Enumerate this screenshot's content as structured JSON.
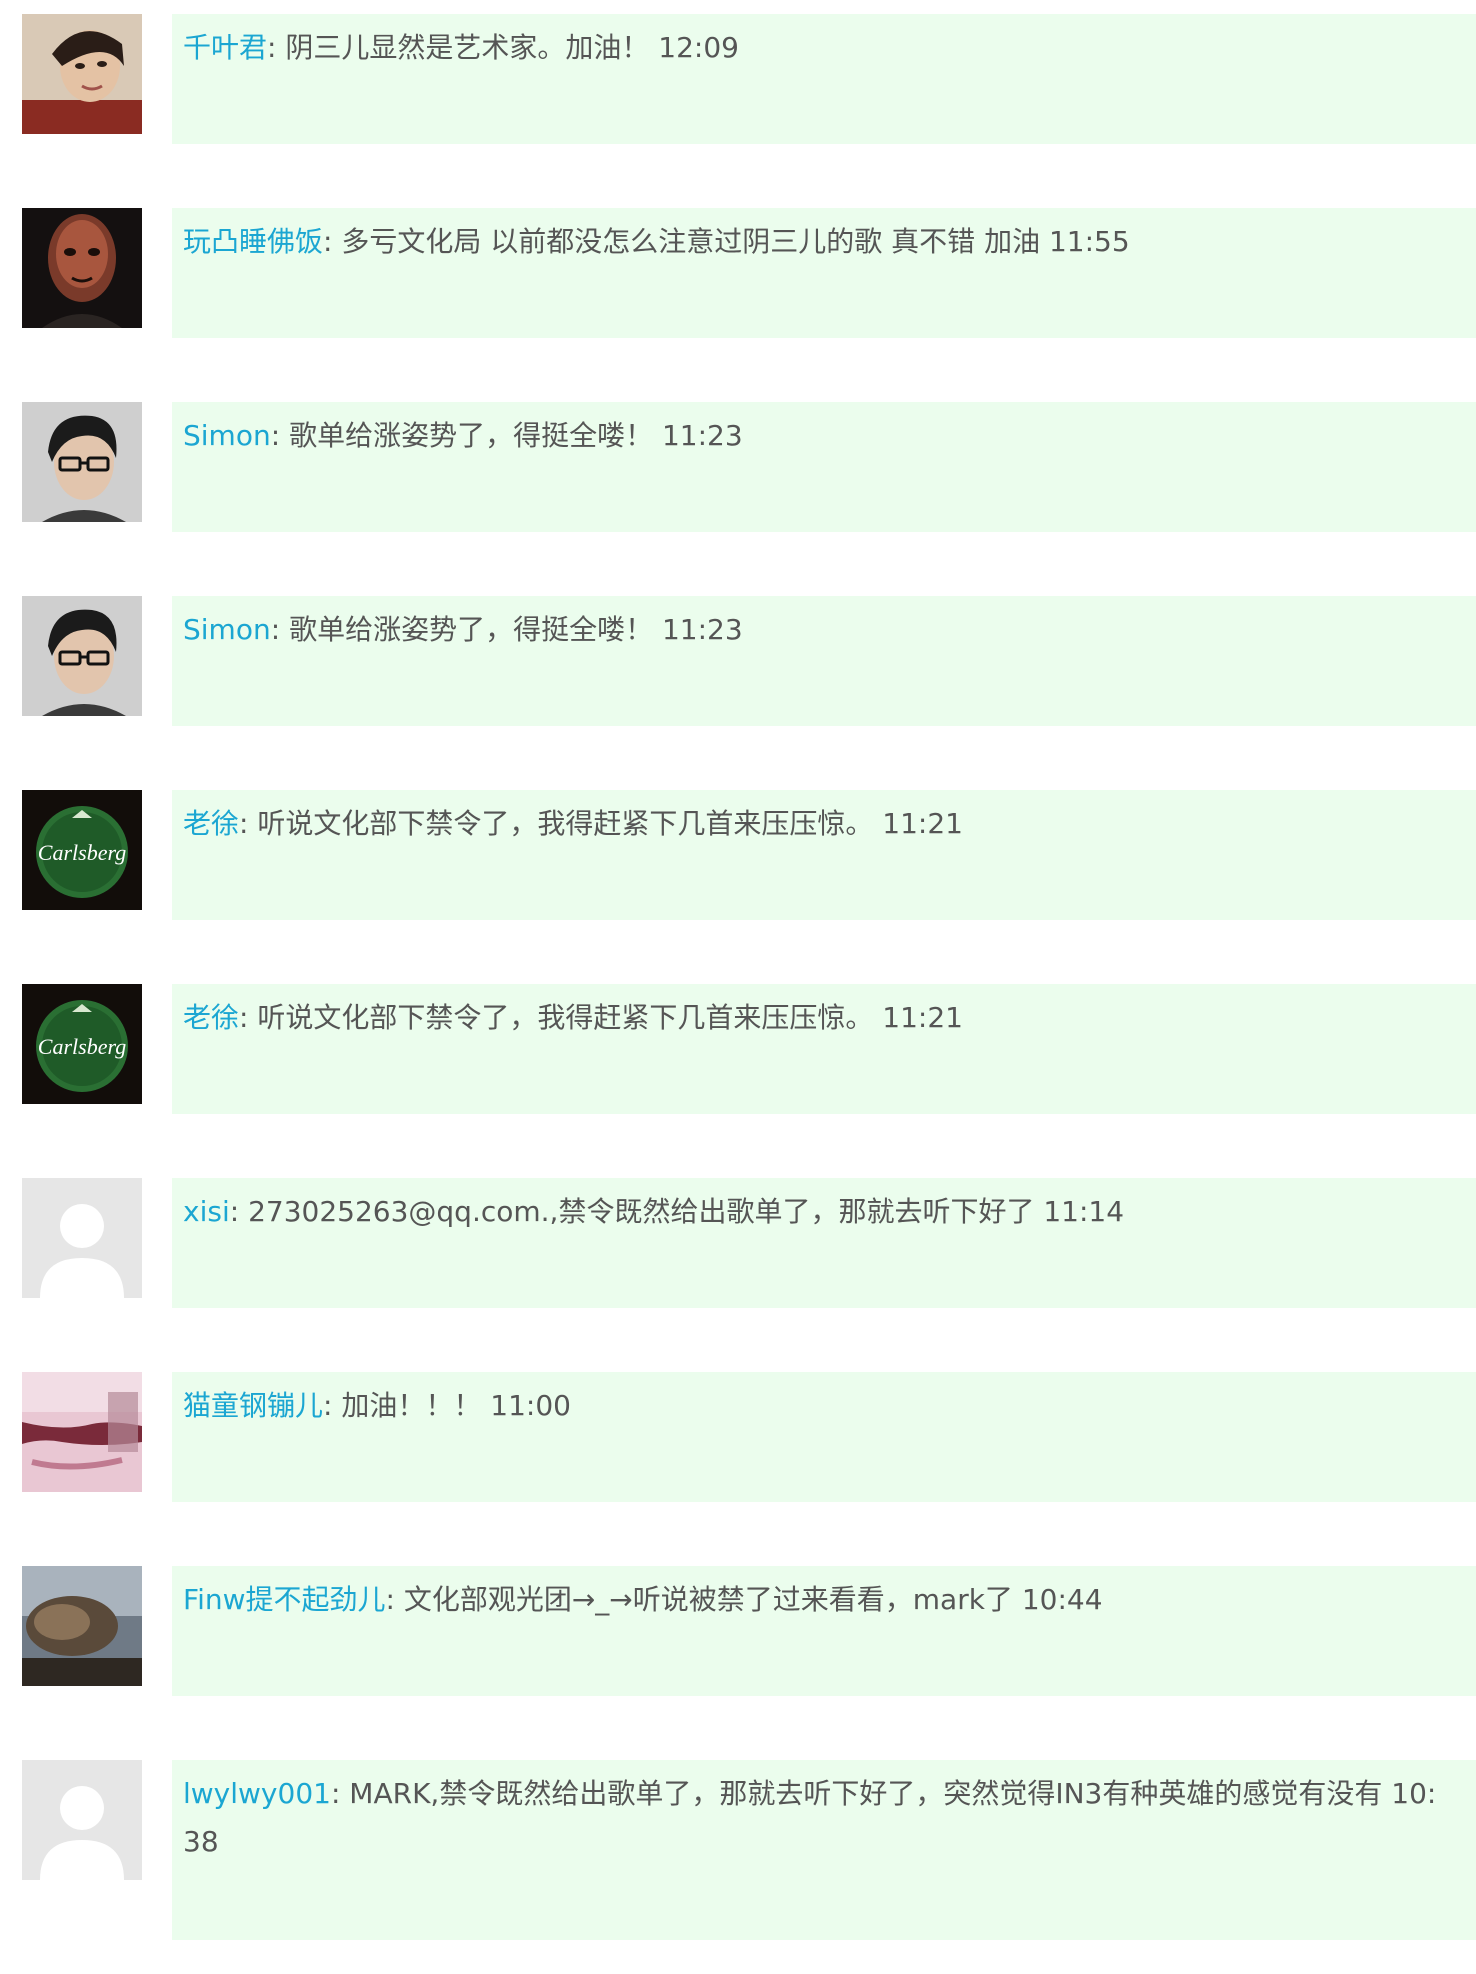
{
  "comments": [
    {
      "user": "千叶君",
      "sep": ": ",
      "text": "阴三儿显然是艺术家。加油！",
      "time": "12:09",
      "avatar": "portrait-woman"
    },
    {
      "user": "玩凸睡佛饭",
      "sep": ": ",
      "text": "多亏文化局 以前都没怎么注意过阴三儿的歌 真不错 加油",
      "time": "11:55",
      "avatar": "dark-face"
    },
    {
      "user": "Simon",
      "sep": ": ",
      "text": "歌单给涨姿势了，得挺全喽！",
      "time": "11:23",
      "avatar": "man-glasses"
    },
    {
      "user": "Simon",
      "sep": ": ",
      "text": "歌单给涨姿势了，得挺全喽！",
      "time": "11:23",
      "avatar": "man-glasses"
    },
    {
      "user": "老徐",
      "sep": ": ",
      "text": "听说文化部下禁令了，我得赶紧下几首来压压惊。",
      "time": "11:21",
      "avatar": "carlsberg-logo"
    },
    {
      "user": "老徐",
      "sep": ": ",
      "text": "听说文化部下禁令了，我得赶紧下几首来压压惊。",
      "time": "11:21",
      "avatar": "carlsberg-logo"
    },
    {
      "user": "xisi",
      "sep": ": ",
      "text": "273025263@qq.com.,禁令既然给出歌单了，那就去听下好了",
      "time": "11:14",
      "avatar": "default-avatar"
    },
    {
      "user": "猫童钢镚儿",
      "sep": ": ",
      "text": "加油！！！",
      "time": "11:00",
      "avatar": "pink-abstract"
    },
    {
      "user": "Finw提不起劲儿",
      "sep": ": ",
      "text": "文化部观光团→_→听说被禁了过来看看，mark了",
      "time": "10:44",
      "avatar": "creature-scene"
    },
    {
      "user": "lwylwy001",
      "sep": ": ",
      "text": "MARK,禁令既然给出歌单了，那就去听下好了，突然觉得IN3有种英雄的感觉有没有",
      "time": "10:38",
      "avatar": "default-avatar"
    }
  ],
  "brand_text": "Carlsberg",
  "colors": {
    "username": "#1ba6d2",
    "text": "#555555",
    "bubble": "#ebfded"
  }
}
